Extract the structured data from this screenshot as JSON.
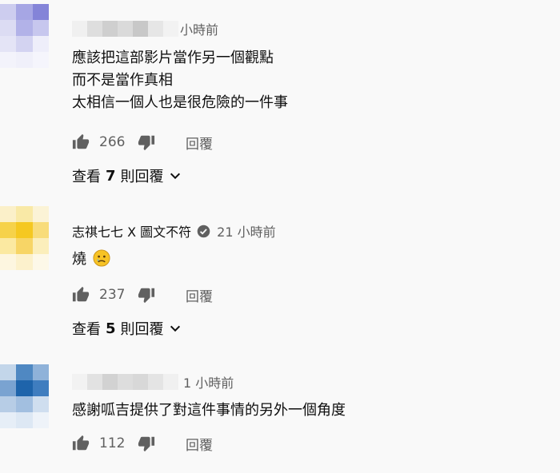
{
  "comments": [
    {
      "author": "",
      "time": "小時前",
      "lines": [
        "應該把這部影片當作另一個觀點",
        "而不是當作真相",
        "太相信一個人也是很危險的一件事"
      ],
      "likes": "266",
      "reply_label": "回覆",
      "view_replies_prefix": "查看",
      "view_replies_count": "7",
      "view_replies_suffix": "則回覆",
      "avatar_colors": [
        "#cdcdef",
        "#a6a6e4",
        "#8484d8",
        "#dcdcf3",
        "#b2b2e8",
        "#c7c7ee",
        "#e4e4f6",
        "#d3d3f1",
        "#eeeefa",
        "#f3f3fb",
        "#f0f0fa",
        "#f5f5fc"
      ],
      "name_mosaic_colors": [
        "#f0f0f0",
        "#dedede",
        "#cfcfcf",
        "#dadada",
        "#c8c8c8",
        "#e6e6e6",
        "#f2f2f2"
      ]
    },
    {
      "author": "志祺七七 X 圖文不符",
      "time": "21 小時前",
      "text": "燒",
      "likes": "237",
      "reply_label": "回覆",
      "view_replies_prefix": "查看",
      "view_replies_count": "5",
      "view_replies_suffix": "則回覆",
      "avatar_colors": [
        "#fbf0c9",
        "#f9e9a6",
        "#fbf3d6",
        "#f6d24a",
        "#f5c821",
        "#f8dc7a",
        "#fbe9a1",
        "#f7d566",
        "#fbeebb",
        "#fdf6e0",
        "#fcf1cc",
        "#fdf8e8"
      ],
      "emoji": "sad-face"
    },
    {
      "author": "",
      "time": "1 小時前",
      "text": "感謝呱吉提供了對這件事情的另外一個角度",
      "likes": "112",
      "reply_label": "回覆",
      "avatar_colors": [
        "#c3d6ea",
        "#4f88c2",
        "#8fb2d9",
        "#7aa3d1",
        "#1e64ab",
        "#3f7dbf",
        "#b7cde6",
        "#a2bfe0",
        "#cfdeef",
        "#e6eef7",
        "#dde8f4",
        "#eef3f9"
      ],
      "name_mosaic_colors": [
        "#f2f2f2",
        "#e2e2e2",
        "#d2d2d2",
        "#dddddd",
        "#d8d8d8",
        "#e4e4e4",
        "#f0f0f0"
      ]
    }
  ]
}
